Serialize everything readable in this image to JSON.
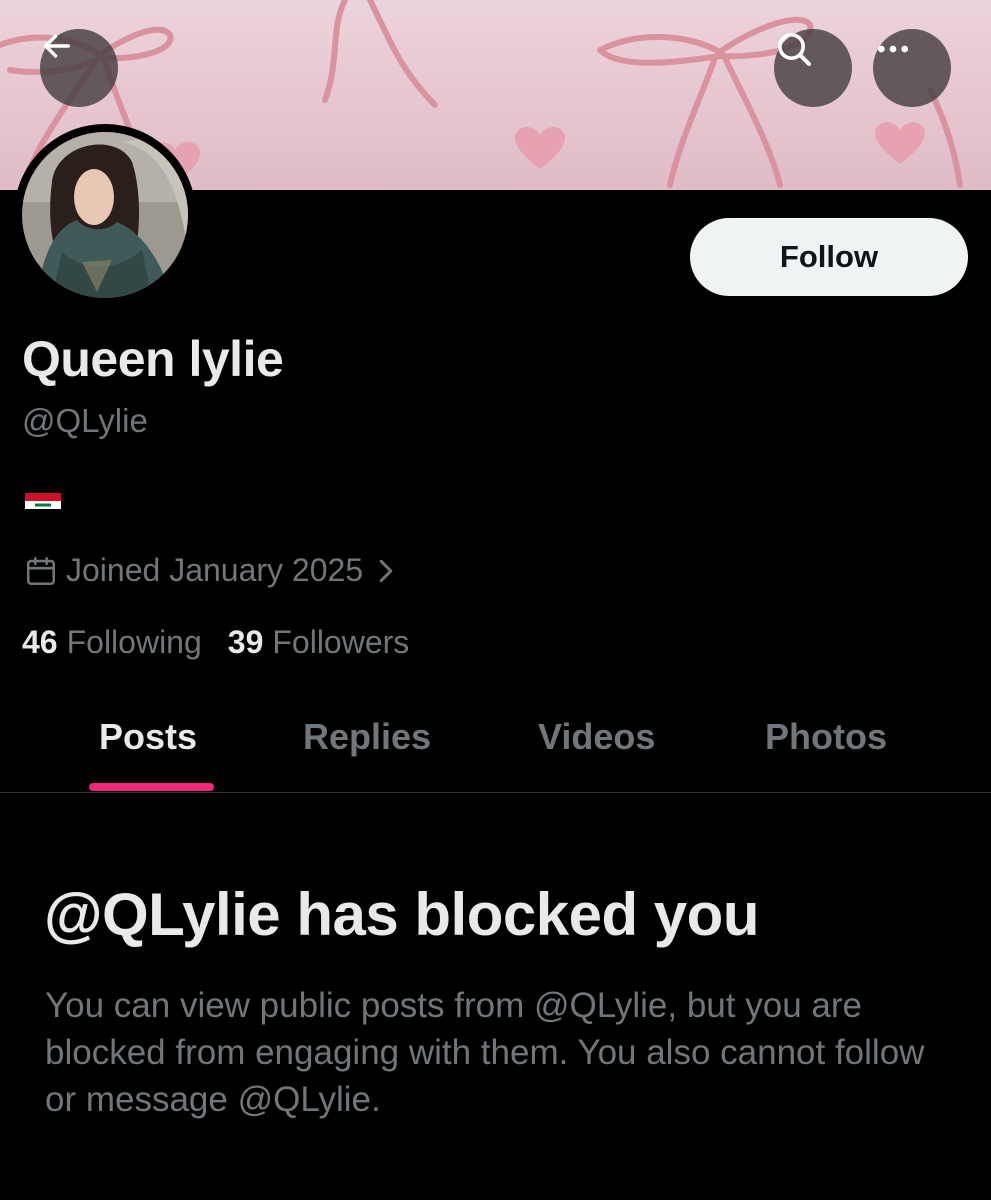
{
  "header": {
    "back_icon": "arrow-left-icon",
    "search_icon": "search-icon",
    "more_icon": "more-horizontal-icon"
  },
  "profile": {
    "display_name": "Queen lylie",
    "handle": "@QLylie",
    "bio_flag": "Iraq flag",
    "joined_text": "Joined January 2025",
    "following_count": "46",
    "following_label": "Following",
    "followers_count": "39",
    "followers_label": "Followers",
    "follow_label": "Follow"
  },
  "tabs": [
    {
      "label": "Posts",
      "active": true
    },
    {
      "label": "Replies",
      "active": false
    },
    {
      "label": "Videos",
      "active": false
    },
    {
      "label": "Photos",
      "active": false
    }
  ],
  "blocked": {
    "title": "@QLylie has blocked you",
    "description": "You can view public posts from @QLylie, but you are blocked from engaging with them. You also cannot follow or message @QLylie."
  },
  "colors": {
    "background": "#000000",
    "accent_indicator": "#f0287a",
    "primary_text": "#e7e9ea",
    "secondary_text": "#71767b",
    "follow_button": "#eff3f4"
  }
}
